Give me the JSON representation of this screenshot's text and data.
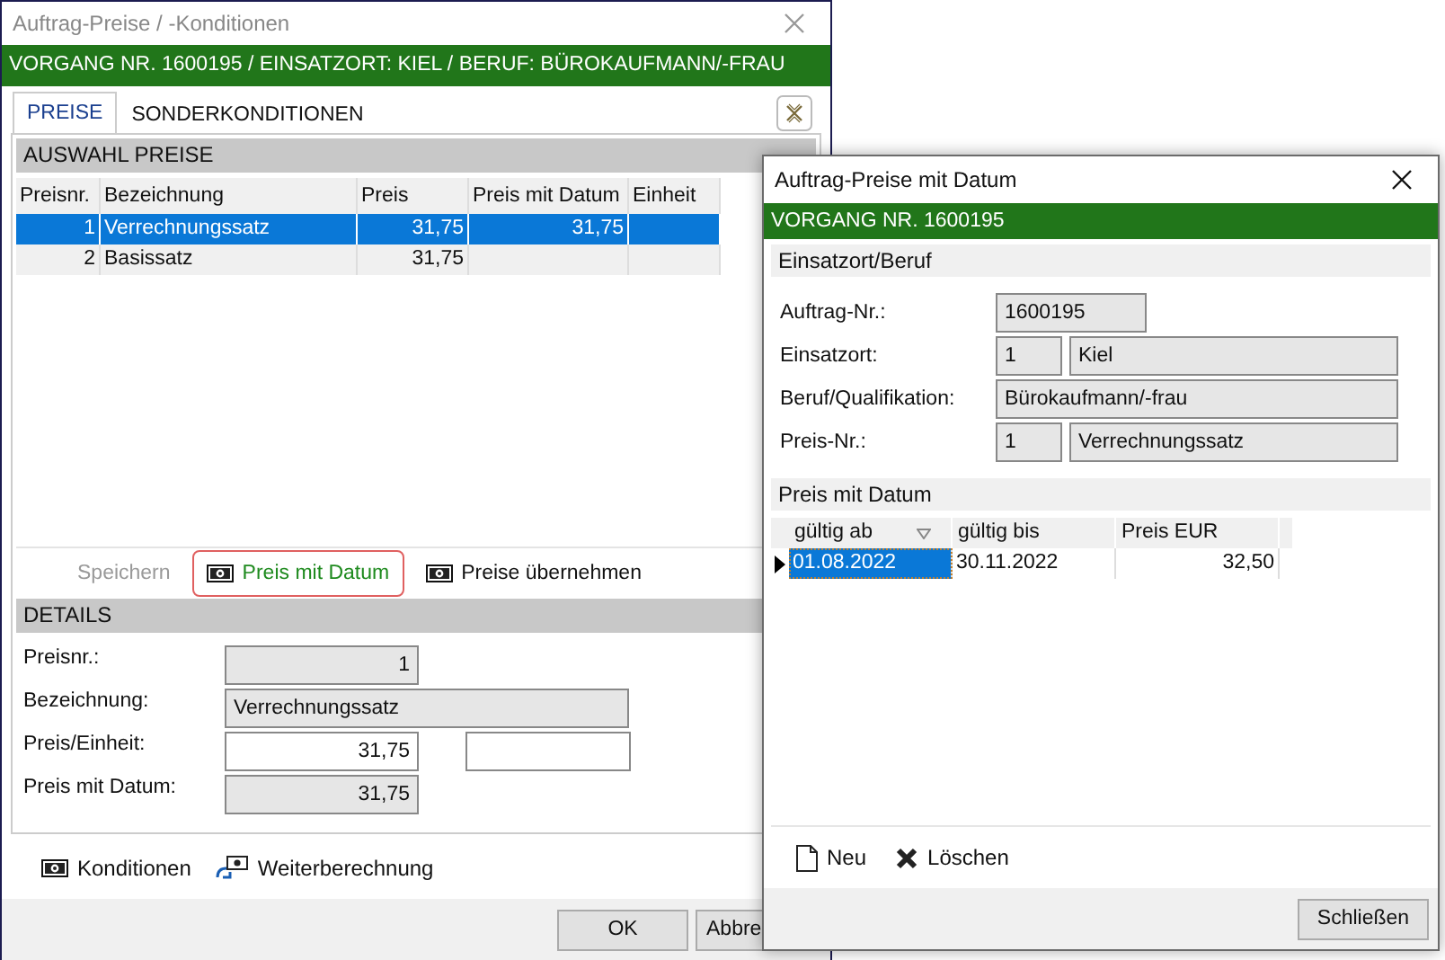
{
  "main_window": {
    "title": "Auftrag-Preise / -Konditionen",
    "banner": "VORGANG NR. 1600195 / EINSATZORT: KIEL / BERUF: BÜROKAUFMANN/-FRAU",
    "tabs": [
      {
        "label": "PREISE",
        "selected": true
      },
      {
        "label": "SONDERKONDITIONEN",
        "selected": false
      }
    ],
    "prices_section": "AUSWAHL PREISE",
    "prices_table": {
      "columns": [
        "Preisnr.",
        "Bezeichnung",
        "Preis",
        "Preis mit Datum",
        "Einheit"
      ],
      "rows": [
        {
          "cells": [
            "1",
            "Verrechnungssatz",
            "31,75",
            "31,75",
            ""
          ],
          "selected": true
        },
        {
          "cells": [
            "2",
            "Basissatz",
            "31,75",
            "",
            ""
          ],
          "selected": false
        }
      ]
    },
    "actions": [
      {
        "label": "Speichern",
        "kind": "plain",
        "disabled": true,
        "highlighted": false
      },
      {
        "label": "Preis mit Datum",
        "kind": "money",
        "disabled": false,
        "highlighted": true
      },
      {
        "label": "Preise übernehmen",
        "kind": "money",
        "disabled": false,
        "highlighted": false
      }
    ],
    "details_section": "DETAILS",
    "details": [
      {
        "label": "Preisnr.:",
        "kind": "number",
        "value": "1",
        "readonly": true
      },
      {
        "label": "Bezeichnung:",
        "kind": "text",
        "value": "Verrechnungssatz",
        "readonly": true
      },
      {
        "label": "Preis/Einheit:",
        "kind": "number_unit",
        "value": "31,75",
        "readonly": false
      },
      {
        "label": "Preis mit Datum:",
        "kind": "number",
        "value": "31,75",
        "readonly": true
      }
    ],
    "links": [
      {
        "label": "Konditionen",
        "kind": "money"
      },
      {
        "label": "Weiterberechnung",
        "kind": "transfer"
      }
    ],
    "buttons": [
      "OK",
      "Abbre"
    ]
  },
  "dialog": {
    "title": "Auftrag-Preise mit Datum",
    "banner": "VORGANG NR. 1600195",
    "place_section": "Einsatzort/Beruf",
    "fields": [
      {
        "label": "Auftrag-Nr.:",
        "kind": "code",
        "values": [
          "1600195"
        ]
      },
      {
        "label": "Einsatzort:",
        "kind": "pair",
        "values": [
          "1",
          "Kiel"
        ]
      },
      {
        "label": "Beruf/Qualifikation:",
        "kind": "text",
        "values": [
          "Bürokaufmann/-frau"
        ]
      },
      {
        "label": "Preis-Nr.:",
        "kind": "pair",
        "values": [
          "1",
          "Verrechnungssatz"
        ]
      }
    ],
    "dates_section": "Preis mit Datum",
    "grid": {
      "columns": [
        {
          "label": "gültig ab",
          "sorted": true
        },
        {
          "label": "gültig bis",
          "sorted": false
        },
        {
          "label": "Preis EUR",
          "sorted": false
        }
      ],
      "rows": [
        {
          "cells": [
            "01.08.2022",
            "30.11.2022",
            "32,50"
          ],
          "selected": true
        }
      ]
    },
    "tools": [
      {
        "label": "Neu",
        "kind": "new"
      },
      {
        "label": "Löschen",
        "kind": "delete"
      }
    ],
    "close_button": "Schließen"
  }
}
